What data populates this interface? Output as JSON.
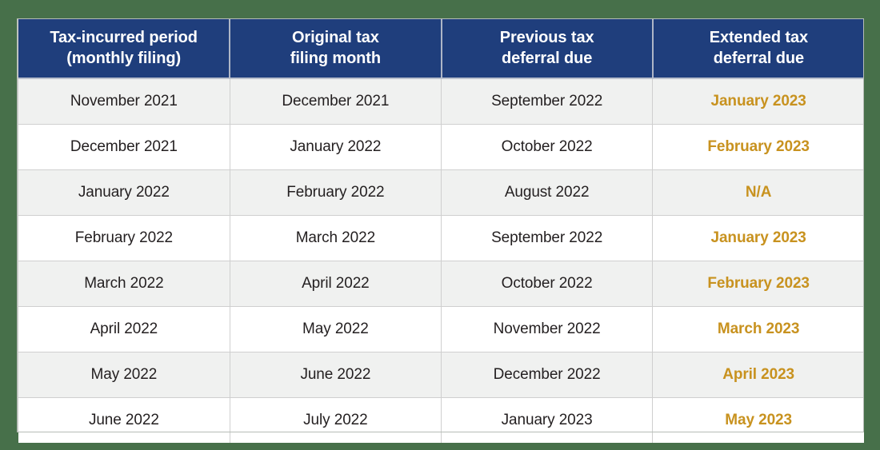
{
  "theme": {
    "background_color": "#47704a",
    "header_color": "#1f3e7c",
    "header_text_color": "#ffffff",
    "row_shade_color": "#f0f1f0",
    "row_plain_color": "#ffffff",
    "body_text_color": "#231f20",
    "accent_color": "#c8921f",
    "border_color": "#cfcfcf"
  },
  "table": {
    "columns": [
      {
        "line1": "Tax-incurred period",
        "line2": "(monthly filing)"
      },
      {
        "line1": "Original tax",
        "line2": "filing month"
      },
      {
        "line1": "Previous tax",
        "line2": "deferral due"
      },
      {
        "line1": "Extended tax",
        "line2": "deferral due"
      }
    ],
    "rows": [
      {
        "tax_incurred_period": "November 2021",
        "original_filing_month": "December 2021",
        "previous_deferral_due": "September 2022",
        "extended_deferral_due": "January 2023"
      },
      {
        "tax_incurred_period": "December 2021",
        "original_filing_month": "January 2022",
        "previous_deferral_due": "October 2022",
        "extended_deferral_due": "February 2023"
      },
      {
        "tax_incurred_period": "January 2022",
        "original_filing_month": "February 2022",
        "previous_deferral_due": "August 2022",
        "extended_deferral_due": "N/A"
      },
      {
        "tax_incurred_period": "February 2022",
        "original_filing_month": "March 2022",
        "previous_deferral_due": "September 2022",
        "extended_deferral_due": "January 2023"
      },
      {
        "tax_incurred_period": "March 2022",
        "original_filing_month": "April 2022",
        "previous_deferral_due": "October 2022",
        "extended_deferral_due": "February 2023"
      },
      {
        "tax_incurred_period": "April 2022",
        "original_filing_month": "May 2022",
        "previous_deferral_due": "November 2022",
        "extended_deferral_due": "March 2023"
      },
      {
        "tax_incurred_period": "May 2022",
        "original_filing_month": "June 2022",
        "previous_deferral_due": "December 2022",
        "extended_deferral_due": "April 2023"
      },
      {
        "tax_incurred_period": "June 2022",
        "original_filing_month": "July 2022",
        "previous_deferral_due": "January 2023",
        "extended_deferral_due": "May 2023"
      }
    ]
  }
}
